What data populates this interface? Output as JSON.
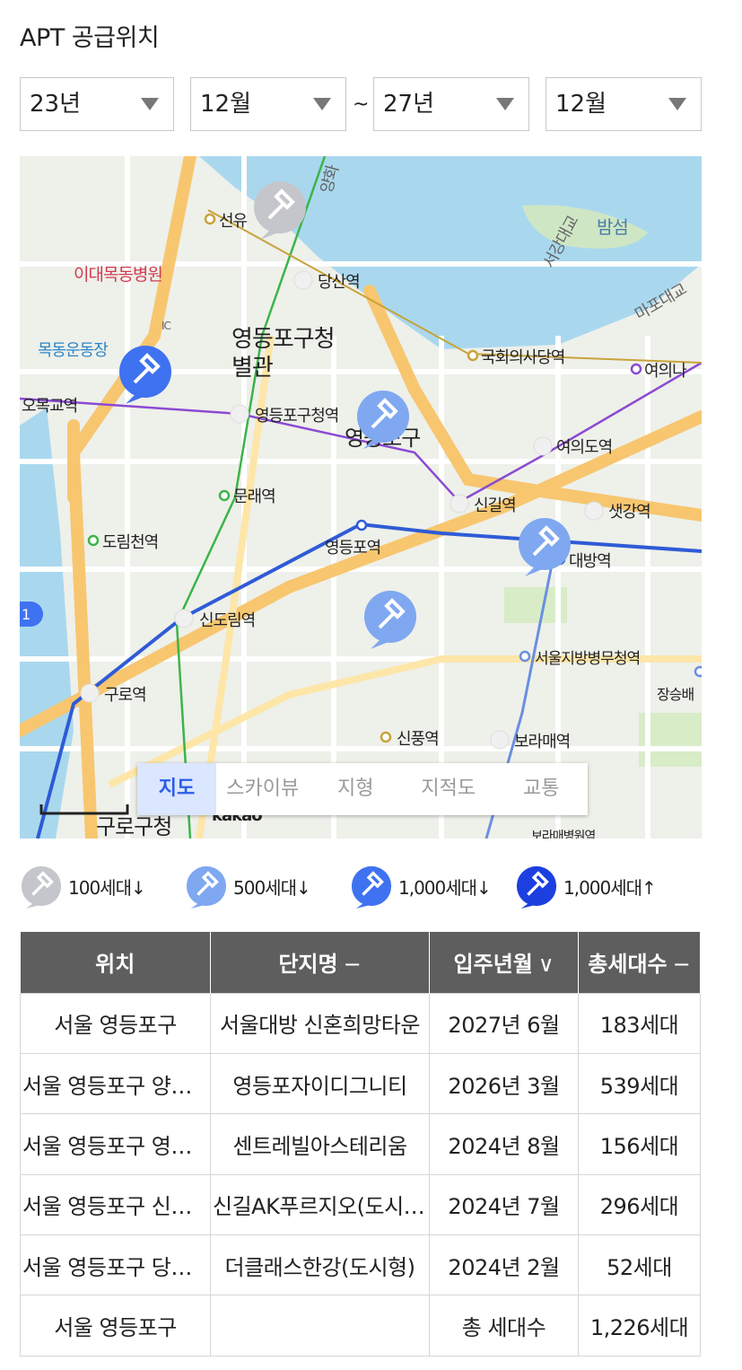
{
  "title": "APT 공급위치",
  "filters": {
    "from_year": "23년",
    "from_month": "12월",
    "separator": "~",
    "to_year": "27년",
    "to_month": "12월"
  },
  "map": {
    "tabs": [
      "지도",
      "스카이뷰",
      "지형",
      "지적도",
      "교통"
    ],
    "active_tab": "지도",
    "labels": {
      "seonyu": "선유",
      "dangsan": "당산역",
      "hospital": "이대목동병원",
      "stadium": "목동운동장",
      "ic": "IC",
      "office": "영등포구청",
      "annex": "별관",
      "omokgyo": "오목교역",
      "yeongdeungpo_office_st": "영등포구청역",
      "district": "영등포구",
      "munrae": "문래역",
      "dorimcheon": "도림천역",
      "yeongdeungpo_st": "영등포역",
      "sindorim": "신도림역",
      "guro": "구로역",
      "singil": "신길역",
      "yeouido": "여의도역",
      "saetgang": "샛강역",
      "daebang": "대방역",
      "assembly": "국회의사당역",
      "yeouinaru": "여의나",
      "seoulgov": "서울지방병무청역",
      "sinpung": "신풍역",
      "boramae": "보라매역",
      "gurogu": "구로구청",
      "kakao": "kakao",
      "bamseom": "밤섬",
      "seogang": "서강대교",
      "mapo": "마포대교",
      "yanghwa": "양화",
      "jangseung": "장승배",
      "boramae_hosp": "보라매병원역",
      "highway": "1"
    }
  },
  "legend": [
    {
      "label": "100세대↓",
      "color": "#c4c6cc"
    },
    {
      "label": "500세대↓",
      "color": "#7fa8f0"
    },
    {
      "label": "1,000세대↓",
      "color": "#3f72f0"
    },
    {
      "label": "1,000세대↑",
      "color": "#1c3fe0"
    }
  ],
  "table": {
    "headers": {
      "location": "위치",
      "complex": "단지명",
      "complex_sort": "−",
      "move_in": "입주년월",
      "move_in_sort": "∨",
      "households": "총세대수",
      "households_sort": "−"
    },
    "rows": [
      {
        "location": "서울 영등포구",
        "complex": "서울대방 신혼희망타운",
        "move_in": "2027년 6월",
        "households": "183세대"
      },
      {
        "location": "서울 영등포구 양평동",
        "complex": "영등포자이디그니티",
        "move_in": "2026년 3월",
        "households": "539세대"
      },
      {
        "location": "서울 영등포구 영등포동",
        "complex": "센트레빌아스테리움",
        "move_in": "2024년 8월",
        "households": "156세대"
      },
      {
        "location": "서울 영등포구 신길동",
        "complex": "신길AK푸르지오(도시형)",
        "move_in": "2024년 7월",
        "households": "296세대"
      },
      {
        "location": "서울 영등포구 당산동",
        "complex": "더클래스한강(도시형)",
        "move_in": "2024년 2월",
        "households": "52세대"
      }
    ],
    "footer": {
      "location": "서울 영등포구",
      "label": "총 세대수",
      "total": "1,226세대"
    }
  }
}
